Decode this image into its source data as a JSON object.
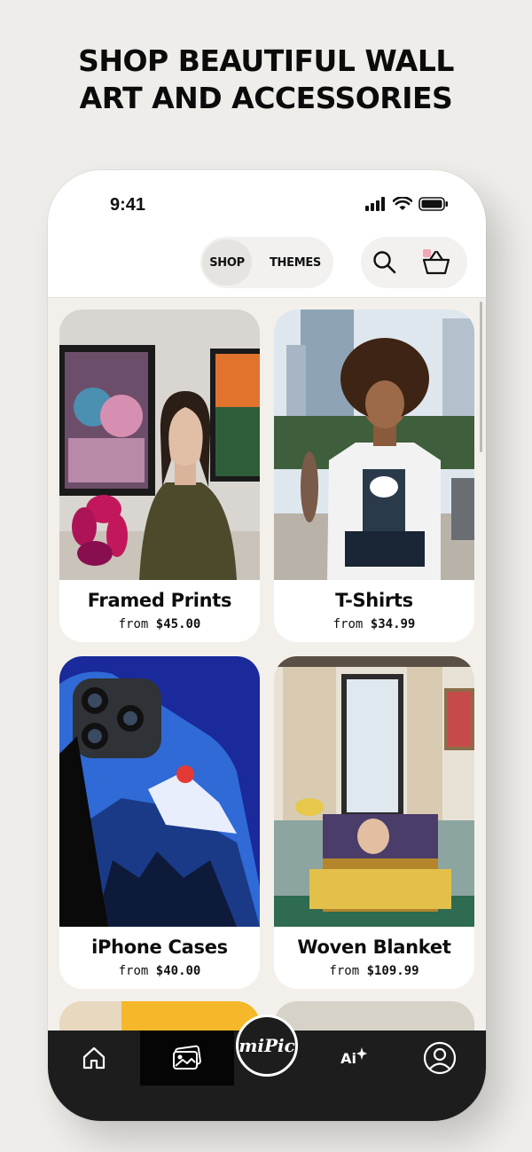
{
  "headline": {
    "line1": "SHOP BEAUTIFUL WALL",
    "line2": "ART AND ACCESSORIES"
  },
  "status_bar": {
    "time": "9:41",
    "icons": [
      "signal-icon",
      "wifi-icon",
      "battery-icon"
    ]
  },
  "header": {
    "segments": [
      {
        "label": "SHOP",
        "selected": true
      },
      {
        "label": "THEMES",
        "selected": false
      }
    ],
    "actions": [
      "search-icon",
      "cart-icon"
    ],
    "cart_badge_color": "#f2a7b4"
  },
  "products": [
    {
      "title": "Framed Prints",
      "from_label": "from",
      "price": "$45.00"
    },
    {
      "title": "T-Shirts",
      "from_label": "from",
      "price": "$34.99"
    },
    {
      "title": "iPhone Cases",
      "from_label": "from",
      "price": "$40.00"
    },
    {
      "title": "Woven Blanket",
      "from_label": "from",
      "price": "$109.99"
    }
  ],
  "bottom_nav": {
    "items": [
      {
        "icon": "home-icon",
        "active": false
      },
      {
        "icon": "gallery-icon",
        "active": true
      },
      {
        "icon": "mipic-logo",
        "label": "miPic"
      },
      {
        "icon": "ai-sparkle-icon",
        "label": "Ai"
      },
      {
        "icon": "profile-icon",
        "active": false
      }
    ]
  },
  "colors": {
    "background": "#efedea",
    "nav_background": "#1d1d1d",
    "nav_active": "#050505",
    "card_background": "#ffffff",
    "text": "#0d0d0d"
  }
}
